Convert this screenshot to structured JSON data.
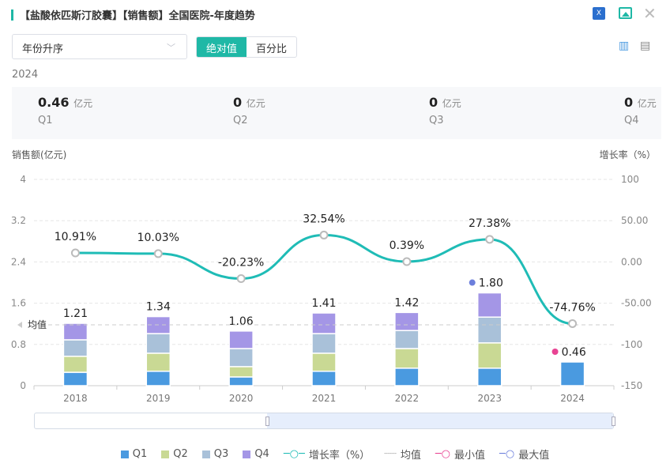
{
  "header": {
    "title": "【盐酸依匹斯汀胶囊】【销售额】全国医院-年度趋势",
    "icons": [
      "excel-export-icon",
      "image-export-icon",
      "close-icon"
    ]
  },
  "controls": {
    "sort_select": "年份升序",
    "toggle": [
      "绝对值",
      "百分比"
    ],
    "view_icons": [
      "bar-chart-icon",
      "document-icon"
    ]
  },
  "summary": {
    "year": "2024",
    "unit": "亿元",
    "cards": [
      {
        "value": "0.46",
        "label": "Q1"
      },
      {
        "value": "0",
        "label": "Q2"
      },
      {
        "value": "0",
        "label": "Q3"
      },
      {
        "value": "0",
        "label": "Q4"
      }
    ]
  },
  "chart_data": {
    "type": "bar",
    "ylabel": "销售额(亿元)",
    "y2label": "增长率（%）",
    "categories": [
      "2018",
      "2019",
      "2020",
      "2021",
      "2022",
      "2023",
      "2024"
    ],
    "ylim": [
      0,
      4
    ],
    "yticks": [
      "0",
      "0.8",
      "1.6",
      "2.4",
      "3.2",
      "4"
    ],
    "y2lim": [
      -150,
      100
    ],
    "y2ticks": [
      "-150",
      "-100",
      "-50.00",
      "0.00",
      "50.00",
      "100"
    ],
    "series": [
      {
        "name": "Q1",
        "color": "#4a9ae0",
        "values": [
          0.26,
          0.28,
          0.17,
          0.28,
          0.34,
          0.34,
          0.46
        ]
      },
      {
        "name": "Q2",
        "color": "#c9d994",
        "values": [
          0.31,
          0.35,
          0.2,
          0.35,
          0.38,
          0.49,
          0
        ]
      },
      {
        "name": "Q3",
        "color": "#a9c1d9",
        "values": [
          0.32,
          0.38,
          0.35,
          0.38,
          0.35,
          0.5,
          0
        ]
      },
      {
        "name": "Q4",
        "color": "#a496e6",
        "values": [
          0.32,
          0.33,
          0.34,
          0.4,
          0.35,
          0.47,
          0
        ]
      }
    ],
    "totals": [
      "1.21",
      "1.34",
      "1.06",
      "1.41",
      "1.42",
      "1.80",
      "0.46"
    ],
    "growth": {
      "name": "增长率（%）",
      "color": "#1fbcb6",
      "values": [
        10.91,
        10.03,
        -20.23,
        32.54,
        0.39,
        27.38,
        -74.76
      ],
      "labels": [
        "10.91%",
        "10.03%",
        "-20.23%",
        "32.54%",
        "0.39%",
        "27.38%",
        "-74.76%"
      ]
    },
    "mean": {
      "label": "均值",
      "value": 1.18
    },
    "max_index": 5,
    "min_index": 6,
    "legend": [
      "Q1",
      "Q2",
      "Q3",
      "Q4",
      "增长率（%）",
      "均值",
      "最小值",
      "最大值"
    ],
    "legend_position": "bottom"
  }
}
